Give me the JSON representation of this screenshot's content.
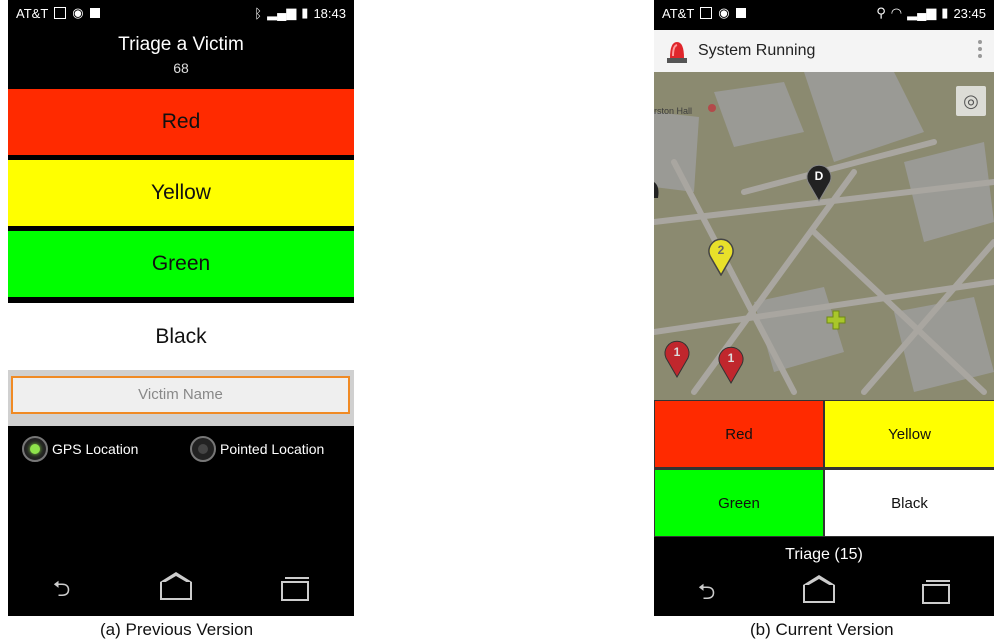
{
  "previous": {
    "status": {
      "carrier": "AT&T",
      "time": "18:43"
    },
    "title": "Triage a Victim",
    "count": "68",
    "buttons": {
      "red": "Red",
      "yellow": "Yellow",
      "green": "Green",
      "black": "Black"
    },
    "name_placeholder": "Victim Name",
    "radios": [
      {
        "label": "GPS Location",
        "selected": true
      },
      {
        "label": "Pointed Location",
        "selected": false
      }
    ],
    "caption": "(a) Previous Version"
  },
  "current": {
    "status": {
      "carrier": "AT&T",
      "time": "23:45"
    },
    "app_title": "System Running",
    "map": {
      "partial_label": "rston Hall"
    },
    "markers": [
      {
        "label": "D",
        "color": "#222222"
      },
      {
        "label": "2",
        "color": "#e8e02a"
      },
      {
        "label": "1",
        "color": "#c0272d"
      },
      {
        "label": "1",
        "color": "#c0272d"
      }
    ],
    "buttons": {
      "red": "Red",
      "yellow": "Yellow",
      "green": "Green",
      "black": "Black"
    },
    "triage": "Triage (15)",
    "caption": "(b) Current Version"
  },
  "colors": {
    "red": "#ff2a00",
    "yellow": "#ffff00",
    "green": "#00ff00",
    "white": "#ffffff",
    "accent_orange": "#f08a24"
  },
  "icons": [
    "back-icon",
    "home-icon",
    "recent-apps-icon",
    "siren-icon",
    "locate-icon",
    "overflow-menu-icon",
    "map-marker-icon",
    "hospital-cross-icon"
  ]
}
